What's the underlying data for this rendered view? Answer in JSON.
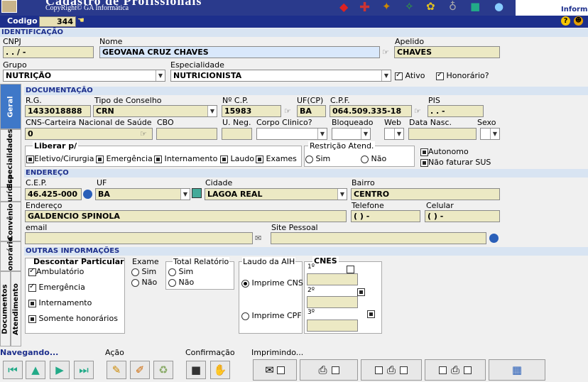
{
  "window": {
    "title": "Cadastro de Profissionais",
    "copyright": "CopyRight© GA Informática",
    "brand": "Informát"
  },
  "codebar": {
    "label": "Codigo",
    "value": "344"
  },
  "identificacao": {
    "section": "IDENTIFICAÇÃO",
    "cnpj_label": "CNPJ",
    "cnpj_value": " .  .  /   -",
    "nome_label": "Nome",
    "nome_value": "GEOVANA CRUZ CHAVES",
    "apelido_label": "Apelido",
    "apelido_value": "CHAVES",
    "grupo_label": "Grupo",
    "grupo_value": "NUTRIÇÃO",
    "especialidade_label": "Especialidade",
    "especialidade_value": "NUTRICIONISTA",
    "ativo_label": "Ativo",
    "honorario_label": "Honorário?"
  },
  "tabs": [
    "Geral",
    "Especialidades",
    "P. Jurídica",
    "Convênio",
    "Honorário",
    "Documentos",
    "Atendimento"
  ],
  "documentacao": {
    "section": "DOCUMENTAÇÃO",
    "rg_label": "R.G.",
    "rg_value": "1433018888",
    "conselho_label": "Tipo de Conselho",
    "conselho_value": "CRN",
    "ncp_label": "Nº C.P.",
    "ncp_value": "15983",
    "ufcp_label": "UF(CP)",
    "ufcp_value": "BA",
    "cpf_label": "C.P.F.",
    "cpf_value": "064.509.335-18",
    "pis_label": "PIS",
    "pis_value": " .   .   -",
    "cns_label": "CNS-Carteira Nacional de Saúde",
    "cns_value": "0",
    "cbo_label": "CBO",
    "uneg_label": "U. Neg.",
    "corpo_label": "Corpo Clinico?",
    "bloqueado_label": "Bloqueado",
    "web_label": "Web",
    "datanasc_label": "Data Nasc.",
    "sexo_label": "Sexo",
    "liberar_label": "Liberar p/",
    "liberar_items": [
      "Eletivo/Cirurgia",
      "Emergência",
      "Internamento",
      "Laudo",
      "Exames"
    ],
    "restricao_label": "Restrição Atend.",
    "sim": "Sim",
    "nao": "Não",
    "autonomo": "Autonomo",
    "nao_faturar": "Não faturar SUS"
  },
  "endereco": {
    "section": "ENDEREÇO",
    "cep_label": "C.E.P.",
    "cep_value": "46.425-000",
    "uf_label": "UF",
    "uf_value": "BA",
    "cidade_label": "Cidade",
    "cidade_value": "LAGOA REAL",
    "bairro_label": "Bairro",
    "bairro_value": "CENTRO",
    "endereco_label": "Endereço",
    "endereco_value": "GALDENCIO SPINOLA",
    "telefone_label": "Telefone",
    "telefone_value": "(  )   -",
    "celular_label": "Celular",
    "celular_value": "(  )   -",
    "email_label": "email",
    "site_label": "Site Pessoal"
  },
  "outras": {
    "section": "OUTRAS INFORMAÇÕES",
    "descontar_label": "Descontar Particular",
    "descontar_items": [
      "Ambulatório",
      "Emergência",
      "Internamento",
      "Somente honorários"
    ],
    "exame_label": "Exame",
    "total_label": "Total Relatório",
    "laudo_label": "Laudo da AIH",
    "imprime_cns": "Imprime CNS",
    "imprime_cpf": "Imprime CPF",
    "cnes_label": "CNES",
    "cnes_rows": [
      "1º",
      "2º",
      "3º"
    ]
  },
  "footer": {
    "navegando": "Navegando...",
    "acao": "Ação",
    "confirmacao": "Confirmação",
    "imprimindo": "Imprimindo..."
  }
}
